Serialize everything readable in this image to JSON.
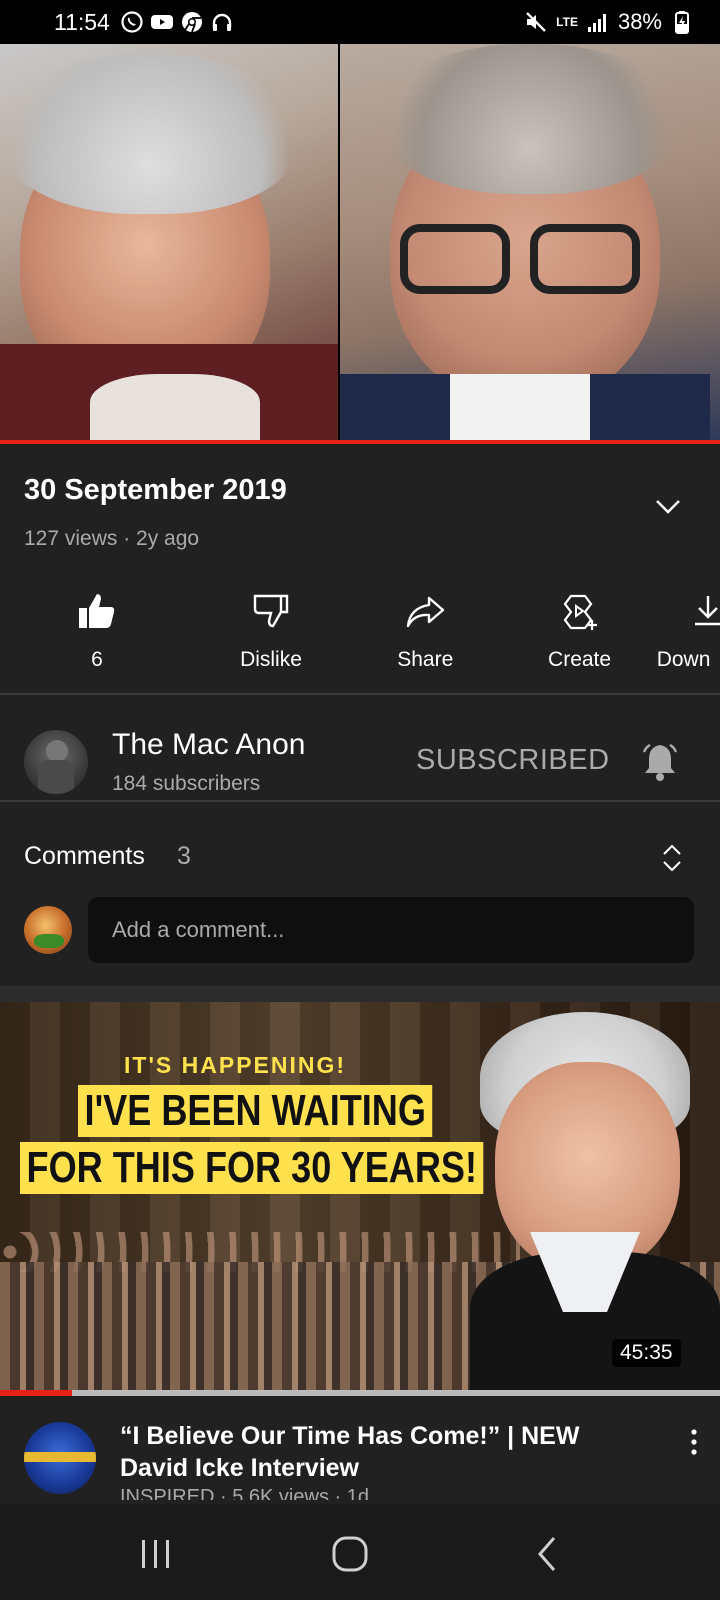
{
  "status_bar": {
    "time": "11:54",
    "battery": "38%",
    "network": "LTE",
    "left_icons": [
      "whatsapp-icon",
      "youtube-icon",
      "chrome-icon",
      "headphones-icon"
    ],
    "right_icons": [
      "mute-icon",
      "lte-icon",
      "signal-icon",
      "battery-charging-icon"
    ]
  },
  "player": {
    "progress": 1.0
  },
  "video": {
    "title": "30 September 2019",
    "meta": "127 views · 2y ago"
  },
  "actions": [
    {
      "label": "6",
      "icon": "like-filled-icon"
    },
    {
      "label": "Dislike",
      "icon": "dislike-icon"
    },
    {
      "label": "Share",
      "icon": "share-icon"
    },
    {
      "label": "Create",
      "icon": "create-icon"
    },
    {
      "label": "Down",
      "icon": "download-icon"
    }
  ],
  "channel": {
    "name": "The Mac Anon",
    "subscribers": "184 subscribers",
    "subscribe_state": "SUBSCRIBED"
  },
  "comments": {
    "label": "Comments",
    "count": "3",
    "placeholder": "Add a comment..."
  },
  "next_video": {
    "thumb_small": "IT'S HAPPENING!",
    "thumb_line1": "I'VE BEEN WAITING",
    "thumb_line2": "FOR THIS FOR 30 YEARS!",
    "duration": "45:35",
    "watched_progress": 0.1,
    "title": "“I Believe Our Time Has Come!” | NEW David Icke Interview",
    "meta": "INSPIRED · 5.6K views · 1d"
  },
  "nav": {
    "buttons": [
      "recent-apps-icon",
      "home-icon",
      "back-icon"
    ]
  }
}
